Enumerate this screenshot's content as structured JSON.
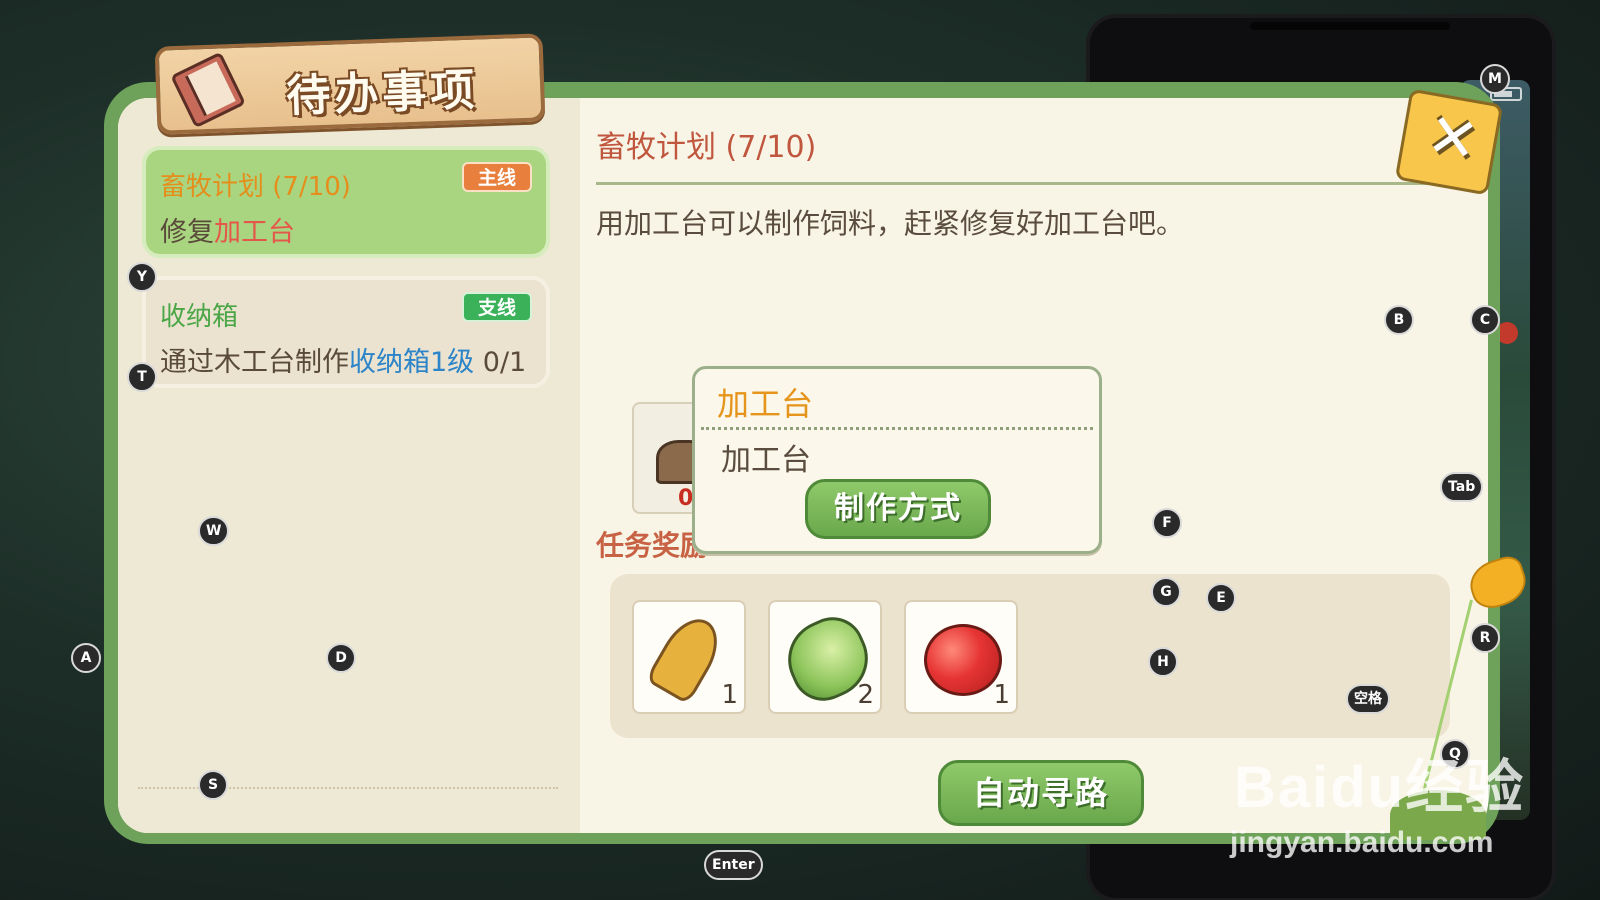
{
  "title": "待办事项",
  "quests": [
    {
      "title": "畜牧计划 (7/10)",
      "badge": "主线",
      "desc_prefix": "修复",
      "desc_highlight": "加工台",
      "desc_suffix": ""
    },
    {
      "title": "收纳箱",
      "badge": "支线",
      "desc_prefix": "通过木工台制作",
      "desc_highlight": "收纳箱1级",
      "desc_suffix": " 0/1"
    }
  ],
  "detail": {
    "title": "畜牧计划 (7/10)",
    "description": "用加工台可以制作饲料，赶紧修复好加工台吧。",
    "item_count": "0",
    "reward_label": "任务奖励",
    "rewards": [
      {
        "icon": "wheat-icon",
        "count": "1"
      },
      {
        "icon": "cabbage-icon",
        "count": "2"
      },
      {
        "icon": "apple-icon",
        "count": "1"
      }
    ],
    "auto_path_button": "自动寻路"
  },
  "popup": {
    "title": "加工台",
    "subtitle": "加工台",
    "recipe_button": "制作方式"
  },
  "close_symbol": "✕",
  "key_hints": {
    "y": "Y",
    "t": "T",
    "w": "W",
    "a": "A",
    "d": "D",
    "s": "S",
    "b": "B",
    "c": "C",
    "m": "M",
    "tab": "Tab",
    "f": "F",
    "g": "G",
    "e": "E",
    "h": "H",
    "r": "R",
    "space": "空格",
    "q": "Q",
    "enter": "Enter"
  },
  "watermark": {
    "main": "Baidu经验",
    "url": "jingyan.baidu.com"
  },
  "colors": {
    "panel_green": "#6ea15a",
    "main_quest_bg": "#a9d580",
    "main_title_orange": "#e58e1c",
    "side_title_green": "#4aa646",
    "highlight_red": "#e5574a",
    "highlight_blue": "#2c84c9",
    "detail_title": "#c0563e",
    "button_green": "#6aa84c"
  }
}
